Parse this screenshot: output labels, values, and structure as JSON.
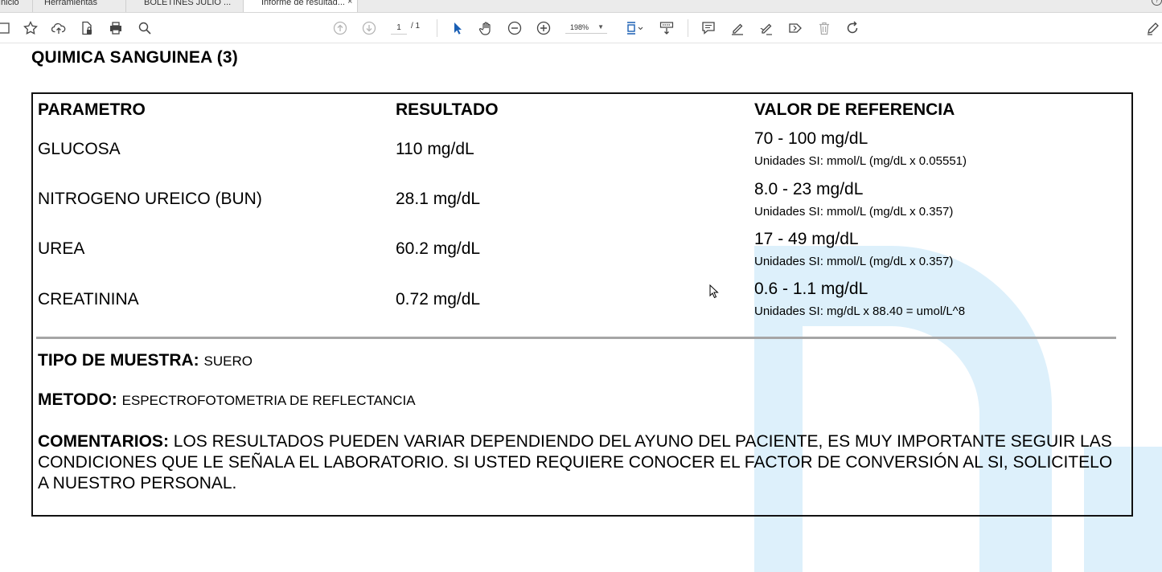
{
  "tabs": [
    {
      "label": "Inicio"
    },
    {
      "label": "Herramientas"
    },
    {
      "label": "BOLETINES JULIO ..."
    },
    {
      "label": "Informe de resultad...",
      "active": true
    }
  ],
  "toolbar": {
    "page_current": "1",
    "page_total": "/ 1",
    "zoom": "198%",
    "icons": [
      "save-icon",
      "star-icon",
      "upload-icon",
      "lock-file-icon",
      "print-icon",
      "search-zoom-icon",
      "page-up-icon",
      "page-down-icon",
      "select-arrow-icon",
      "hand-icon",
      "zoom-out-icon",
      "zoom-in-icon",
      "fit-page-icon",
      "keyboard-scroll-icon",
      "comment-icon",
      "highlight-icon",
      "sign-icon",
      "stamp-icon",
      "delete-icon",
      "rotate-icon",
      "pen-icon"
    ]
  },
  "report": {
    "title": "QUIMICA SANGUINEA (3)",
    "headers": {
      "parameter": "PARAMETRO",
      "result": "RESULTADO",
      "reference": "VALOR DE REFERENCIA"
    },
    "rows": [
      {
        "parameter": "GLUCOSA",
        "result": "110 mg/dL",
        "ref_range": "70 - 100 mg/dL",
        "ref_units": "Unidades SI: mmol/L (mg/dL x 0.05551)"
      },
      {
        "parameter": "NITROGENO UREICO (BUN)",
        "result": "28.1 mg/dL",
        "ref_range": "8.0 - 23 mg/dL",
        "ref_units": "Unidades SI: mmol/L (mg/dL x 0.357)"
      },
      {
        "parameter": "UREA",
        "result": "60.2 mg/dL",
        "ref_range": "17 - 49 mg/dL",
        "ref_units": "Unidades SI: mmol/L (mg/dL x 0.357)"
      },
      {
        "parameter": "CREATININA",
        "result": "0.72 mg/dL",
        "ref_range": "0.6 - 1.1 mg/dL",
        "ref_units": "Unidades SI: mg/dL x 88.40 = umol/L^8"
      }
    ],
    "sample_label": "TIPO DE MUESTRA:",
    "sample_value": "SUERO",
    "method_label": "METODO:",
    "method_value": "ESPECTROFOTOMETRIA DE REFLECTANCIA",
    "comments_label": "COMENTARIOS:",
    "comments_value": "LOS RESULTADOS PUEDEN VARIAR DEPENDIENDO DEL AYUNO DEL PACIENTE, ES MUY IMPORTANTE SEGUIR LAS CONDICIONES QUE LE SEÑALA EL LABORATORIO. SI USTED REQUIERE CONOCER EL FACTOR DE CONVERSIÓN AL SI, SOLICITELO A NUESTRO PERSONAL."
  },
  "colors": {
    "watermark": "#ddf0fb",
    "toolbar_icon": "#444444",
    "active_tool": "#1a5fb4"
  }
}
